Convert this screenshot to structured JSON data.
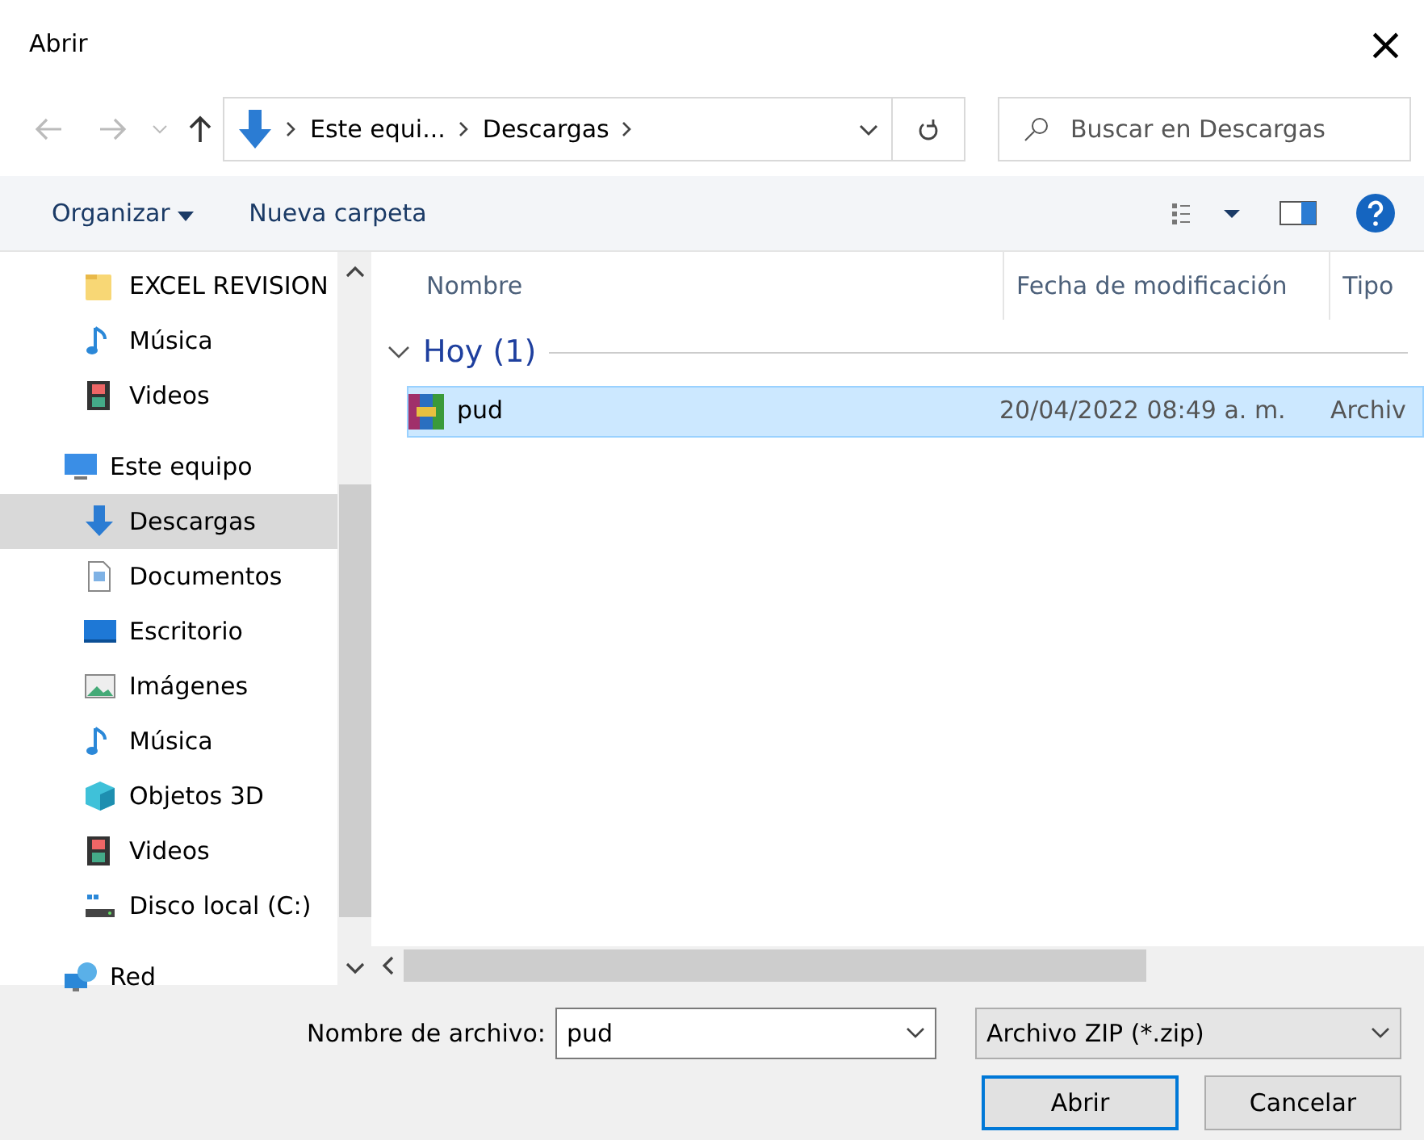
{
  "window": {
    "title": "Abrir",
    "close": "×"
  },
  "address": {
    "segments": [
      "Este equi...",
      "Descargas"
    ],
    "search_placeholder": "Buscar en Descargas"
  },
  "toolbar": {
    "organize": "Organizar",
    "new_folder": "Nueva carpeta"
  },
  "sidebar": {
    "pinned": [
      {
        "kind": "folder",
        "label": "EXCEL REVISION",
        "selected": false
      },
      {
        "kind": "music",
        "label": "Música",
        "selected": false
      },
      {
        "kind": "video",
        "label": "Videos",
        "selected": false
      }
    ],
    "items": [
      {
        "kind": "pc",
        "label": "Este equipo",
        "selected": false,
        "children": [
          {
            "kind": "download",
            "label": "Descargas",
            "selected": true
          },
          {
            "kind": "document",
            "label": "Documentos",
            "selected": false
          },
          {
            "kind": "desktop",
            "label": "Escritorio",
            "selected": false
          },
          {
            "kind": "image",
            "label": "Imágenes",
            "selected": false
          },
          {
            "kind": "music",
            "label": "Música",
            "selected": false
          },
          {
            "kind": "cube",
            "label": "Objetos 3D",
            "selected": false
          },
          {
            "kind": "video",
            "label": "Videos",
            "selected": false
          },
          {
            "kind": "drive",
            "label": "Disco local (C:)",
            "selected": false
          }
        ]
      },
      {
        "kind": "network",
        "label": "Red",
        "selected": false
      }
    ]
  },
  "table": {
    "columns": [
      "Nombre",
      "Fecha de modificación",
      "Tipo"
    ],
    "groups": [
      {
        "label": "Hoy (1)",
        "expanded": true,
        "rows": [
          {
            "name": "pud",
            "date": "20/04/2022 08:49 a. m.",
            "type": "Archiv",
            "selected": true
          }
        ]
      }
    ]
  },
  "footer": {
    "filename_label": "Nombre de archivo:",
    "filename": "pud",
    "filter": "Archivo ZIP (*.zip)",
    "buttons": [
      "Abrir",
      "Cancelar"
    ]
  }
}
